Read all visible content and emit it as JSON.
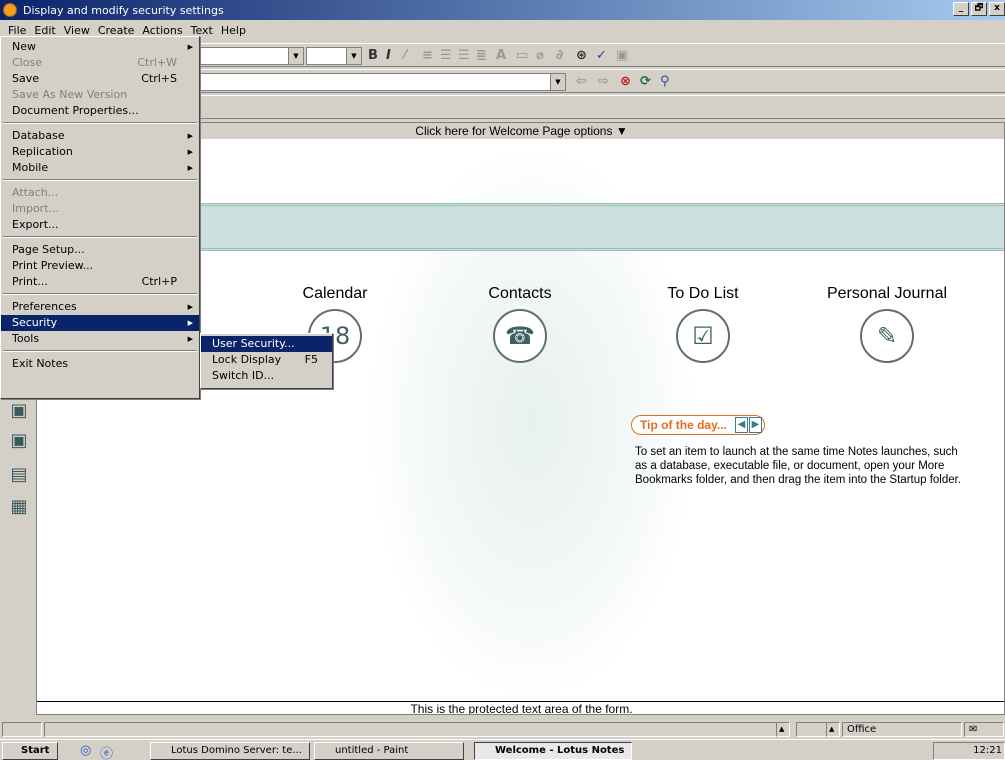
{
  "window": {
    "title": "Display and modify security settings",
    "minimize": "_",
    "restore": "🗗",
    "close": "x"
  },
  "menubar": [
    "File",
    "Edit",
    "View",
    "Create",
    "Actions",
    "Text",
    "Help"
  ],
  "file_menu": [
    {
      "label": "New",
      "submenu": true
    },
    {
      "label": "Close",
      "shortcut": "Ctrl+W",
      "disabled": true
    },
    {
      "label": "Save",
      "shortcut": "Ctrl+S"
    },
    {
      "label": "Save As New Version",
      "disabled": true
    },
    {
      "label": "Document Properties..."
    },
    {
      "label": "Database",
      "submenu": true
    },
    {
      "label": "Replication",
      "submenu": true
    },
    {
      "label": "Mobile",
      "submenu": true
    },
    {
      "label": "Attach...",
      "disabled": true
    },
    {
      "label": "Import...",
      "disabled": true
    },
    {
      "label": "Export..."
    },
    {
      "label": "Page Setup..."
    },
    {
      "label": "Print Preview..."
    },
    {
      "label": "Print...",
      "shortcut": "Ctrl+P"
    },
    {
      "label": "Preferences",
      "submenu": true
    },
    {
      "label": "Security",
      "submenu": true,
      "highlighted": true
    },
    {
      "label": "Tools",
      "submenu": true
    },
    {
      "label": "Exit Notes"
    }
  ],
  "security_menu": [
    {
      "label": "User Security...",
      "highlighted": true
    },
    {
      "label": "Lock Display",
      "shortcut": "F5"
    },
    {
      "label": "Switch ID..."
    }
  ],
  "welcome": {
    "options_bar": "Click here for Welcome Page options ▼",
    "launchers": [
      {
        "label": "Calendar",
        "icon": "calendar-icon",
        "glyph": "18"
      },
      {
        "label": "Contacts",
        "icon": "contacts-icon",
        "glyph": "☎"
      },
      {
        "label": "To Do List",
        "icon": "todo-icon",
        "glyph": "☑"
      },
      {
        "label": "Personal Journal",
        "icon": "journal-icon",
        "glyph": "✎"
      }
    ],
    "tip_title": "Tip of the day...",
    "tip_prev": "◀",
    "tip_next": "▶",
    "tip_text": "To set an item to launch at the same time Notes launches, such as a database, executable file, or document, open your More Bookmarks folder, and then drag the item into the Startup folder.",
    "protected_text": "This is the protected text area of the form."
  },
  "statusbar": {
    "location": "Office"
  },
  "taskbar": {
    "start": "Start",
    "tasks": [
      "Lotus Domino Server: te...",
      "untitled - Paint",
      "Welcome - Lotus Notes"
    ],
    "clock": "12:21"
  }
}
